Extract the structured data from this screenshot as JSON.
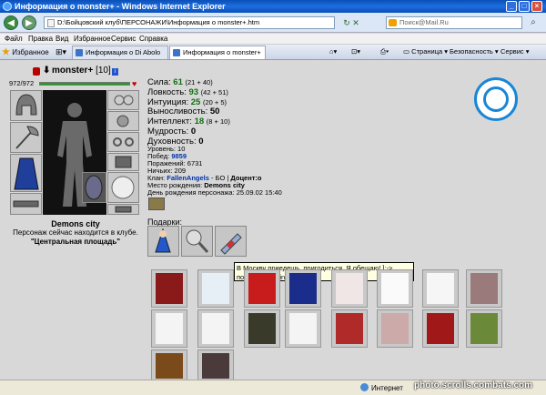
{
  "window": {
    "title": "Информация о monster+ - Windows Internet Explorer",
    "buttons": {
      "minimize": "_",
      "maximize": "□",
      "close": "×"
    }
  },
  "address_bar": {
    "url": "D:\\Бойцовский клуб\\ПЕРСОНАЖИ\\Информация о monster+.htm",
    "search_placeholder": "Поиск@Mail.Ru"
  },
  "menu": [
    "Файл",
    "Правка",
    "Вид",
    "Избранное",
    "Сервис",
    "Справка"
  ],
  "tabs": {
    "favorites_label": "Избранное",
    "items": [
      {
        "label": "Информация о Di Abolo",
        "active": false
      },
      {
        "label": "Информация о monster+",
        "active": true
      }
    ],
    "toolbar_right": [
      "Страница",
      "Безопасность",
      "Сервис"
    ]
  },
  "character": {
    "name": "monster+",
    "level": "[10]",
    "level_badge": "i",
    "hp": "972/972",
    "city": "Demons city",
    "location_line1": "Персонаж сейчас находится в клубе.",
    "location_line2": "\"Центральная площадь\""
  },
  "stats": [
    {
      "label": "Сила:",
      "value": "61",
      "extra": "(21 + 40)"
    },
    {
      "label": "Ловкость:",
      "value": "93",
      "extra": "(42 + 51)"
    },
    {
      "label": "Интуиция:",
      "value": "25",
      "extra": "(20 + 5)"
    },
    {
      "label": "Выносливость:",
      "value": "50",
      "extra": ""
    },
    {
      "label": "Интеллект:",
      "value": "18",
      "extra": "(8 + 10)"
    },
    {
      "label": "Мудрость:",
      "value": "0",
      "extra": ""
    },
    {
      "label": "Духовность:",
      "value": "0",
      "extra": ""
    }
  ],
  "info": {
    "level": "Уровень: 10",
    "wins_label": "Побед:",
    "wins": "9859",
    "losses": "Поражений: 6731",
    "draws": "Ничьих: 209",
    "clan_label": "Клан:",
    "clan": "FallenAngels",
    "clan_rest": "- БО |",
    "clan_role": "Доцент:о",
    "birthplace_label": "Место рождения:",
    "birthplace": "Demons city",
    "birthday": "День рождения персонажа: 25.09.02 15:40"
  },
  "gifts": {
    "label": "Подарки:",
    "tooltip": "В Москву приедешь, пригодиться. Я обещаю! ]:-> подарок от Princessa"
  },
  "status": {
    "zone": "Интернет",
    "watermark": "photo.scrolls.combats.com"
  },
  "colors": {
    "title_blue": "#0a4fb8",
    "stat_green": "#107010",
    "clan_blue": "#0033aa",
    "crest_blue": "#1a86d6"
  }
}
